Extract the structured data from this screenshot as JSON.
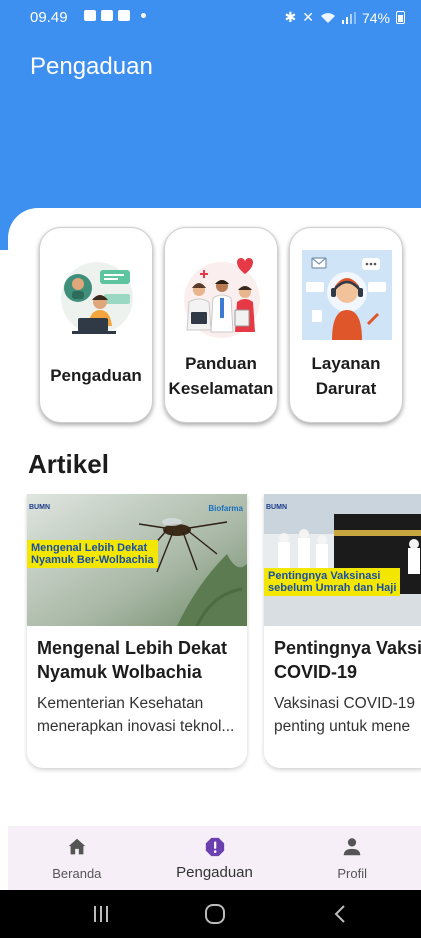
{
  "status_bar": {
    "time": "09.49",
    "battery": "74%"
  },
  "header": {
    "title": "Pengaduan"
  },
  "menu_cards": [
    {
      "label_line1": "Pengaduan",
      "label_line2": "",
      "icon": "complaint-illustration"
    },
    {
      "label_line1": "Panduan",
      "label_line2": "Keselamatan",
      "icon": "medical-team-illustration"
    },
    {
      "label_line1": "Layanan",
      "label_line2": "Darurat",
      "icon": "call-center-illustration"
    }
  ],
  "articles_section": {
    "title": "Artikel",
    "items": [
      {
        "image_logo": "BUMN",
        "image_brand": "Biofarma",
        "image_banner_line1": "Mengenal Lebih Dekat",
        "image_banner_line2": "Nyamuk Ber-Wolbachia",
        "title_line1": "Mengenal Lebih Dekat",
        "title_line2": "Nyamuk Wolbachia",
        "desc_line1": "Kementerian Kesehatan",
        "desc_line2": "menerapkan inovasi teknol..."
      },
      {
        "image_logo": "BUMN",
        "image_banner_line1": "Pentingnya Vaksinasi",
        "image_banner_line2": "sebelum Umrah dan Haji",
        "title_line1": "Pentingnya Vaksi",
        "title_line2": "COVID-19",
        "desc_line1": "Vaksinasi COVID-19",
        "desc_line2": "penting untuk mene"
      }
    ]
  },
  "bottom_nav": {
    "items": [
      {
        "label": "Beranda",
        "icon": "home-icon"
      },
      {
        "label": "Pengaduan",
        "icon": "alert-icon",
        "active": true
      },
      {
        "label": "Profil",
        "icon": "person-icon"
      }
    ]
  },
  "colors": {
    "header": "#3d8ff0",
    "nav_background": "#f6eff8",
    "nav_active": "#6b3fb0"
  }
}
